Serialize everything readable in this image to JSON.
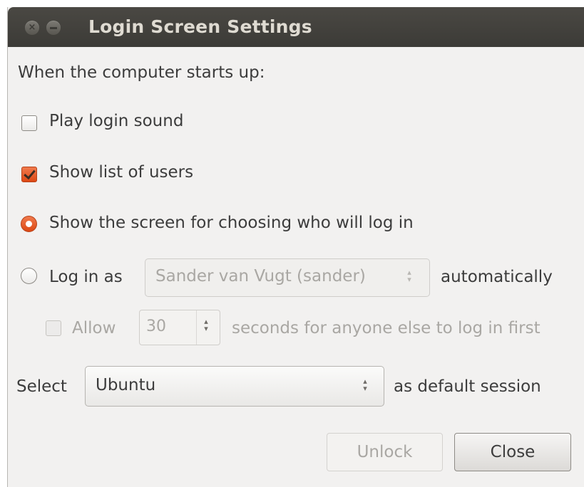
{
  "window": {
    "title": "Login Screen Settings",
    "close_glyph": "×"
  },
  "header_text": "When the computer starts up:",
  "options": {
    "play_login_sound": {
      "label": "Play login sound",
      "checked": false
    },
    "show_list_of_users": {
      "label": "Show list of users",
      "checked": true
    },
    "choose_screen": {
      "label": "Show the screen for choosing who will log in",
      "selected": true
    },
    "auto_login": {
      "label": "Log in as",
      "user_value": "Sander van Vugt (sander)",
      "suffix": "automatically",
      "selected": false,
      "enabled": false
    },
    "allow_delay": {
      "label": "Allow",
      "seconds_value": "30",
      "suffix": "seconds for anyone else to log in first",
      "checked": false,
      "enabled": false
    }
  },
  "session": {
    "prefix": "Select",
    "value": "Ubuntu",
    "suffix": "as default session"
  },
  "buttons": {
    "unlock": "Unlock",
    "close": "Close"
  },
  "colors": {
    "accent": "#dd4814",
    "titlebar": "#3c3b37",
    "window_bg": "#f2f1f0"
  },
  "icons": {
    "window_close": "close-icon",
    "window_minimize": "minimize-icon",
    "spinner": "up-down-arrows-icon"
  }
}
